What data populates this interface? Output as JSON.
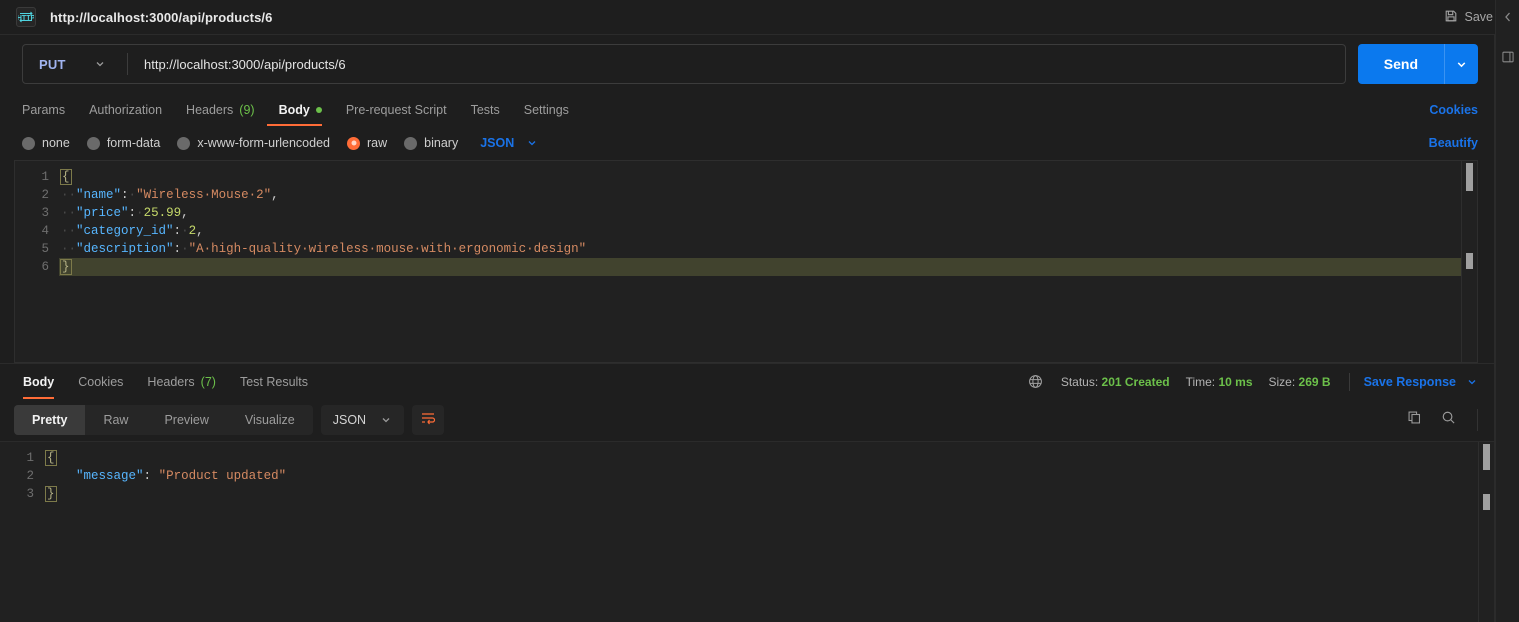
{
  "header": {
    "icon": "http-badge-icon",
    "title": "http://localhost:3000/api/products/6",
    "save_label": "Save",
    "save_icon": "floppy-disk-icon"
  },
  "right_rail": {
    "items": [
      {
        "icon": "chevron-left-icon"
      },
      {
        "icon": "panel-square-icon"
      }
    ]
  },
  "request": {
    "method": "PUT",
    "method_color": "#a1b4f0",
    "url": "http://localhost:3000/api/products/6",
    "url_placeholder": "Enter URL or paste text",
    "send_label": "Send",
    "send_color": "#0b79ee",
    "tabs": [
      {
        "label": "Params",
        "count": "",
        "active": false,
        "dot": false
      },
      {
        "label": "Authorization",
        "count": "",
        "active": false,
        "dot": false
      },
      {
        "label": "Headers",
        "count": "(9)",
        "active": false,
        "dot": false
      },
      {
        "label": "Body",
        "count": "",
        "active": true,
        "dot": true
      },
      {
        "label": "Pre-request Script",
        "count": "",
        "active": false,
        "dot": false
      },
      {
        "label": "Tests",
        "count": "",
        "active": false,
        "dot": false
      },
      {
        "label": "Settings",
        "count": "",
        "active": false,
        "dot": false
      }
    ],
    "cookies_label": "Cookies",
    "beautify_label": "Beautify",
    "body_types": [
      {
        "label": "none",
        "selected": false
      },
      {
        "label": "form-data",
        "selected": false
      },
      {
        "label": "x-www-form-urlencoded",
        "selected": false
      },
      {
        "label": "raw",
        "selected": true
      },
      {
        "label": "binary",
        "selected": false
      }
    ],
    "raw_format": "JSON",
    "accent_color": "#ff6c37",
    "body_code": {
      "lines": [
        {
          "n": "1",
          "tokens": [
            {
              "t": "{",
              "c": "brace"
            }
          ],
          "active": false
        },
        {
          "n": "2",
          "tokens": [
            {
              "t": "··",
              "c": "dot"
            },
            {
              "t": "\"name\"",
              "c": "k"
            },
            {
              "t": ":",
              "c": "p"
            },
            {
              "t": "·",
              "c": "dot"
            },
            {
              "t": "\"Wireless·Mouse·2\"",
              "c": "s"
            },
            {
              "t": ",",
              "c": "p"
            }
          ],
          "active": false
        },
        {
          "n": "3",
          "tokens": [
            {
              "t": "··",
              "c": "dot"
            },
            {
              "t": "\"price\"",
              "c": "k"
            },
            {
              "t": ":",
              "c": "p"
            },
            {
              "t": "·",
              "c": "dot"
            },
            {
              "t": "25.99",
              "c": "n"
            },
            {
              "t": ",",
              "c": "p"
            }
          ],
          "active": false
        },
        {
          "n": "4",
          "tokens": [
            {
              "t": "··",
              "c": "dot"
            },
            {
              "t": "\"category_id\"",
              "c": "k"
            },
            {
              "t": ":",
              "c": "p"
            },
            {
              "t": "·",
              "c": "dot"
            },
            {
              "t": "2",
              "c": "n"
            },
            {
              "t": ",",
              "c": "p"
            }
          ],
          "active": false
        },
        {
          "n": "5",
          "tokens": [
            {
              "t": "··",
              "c": "dot"
            },
            {
              "t": "\"description\"",
              "c": "k"
            },
            {
              "t": ":",
              "c": "p"
            },
            {
              "t": "·",
              "c": "dot"
            },
            {
              "t": "\"A·high-quality·wireless·mouse·with·ergonomic·design\"",
              "c": "s"
            }
          ],
          "active": false
        },
        {
          "n": "6",
          "tokens": [
            {
              "t": "}",
              "c": "brace"
            }
          ],
          "active": true
        }
      ]
    }
  },
  "response": {
    "tabs": [
      {
        "label": "Body",
        "count": "",
        "active": true
      },
      {
        "label": "Cookies",
        "count": "",
        "active": false
      },
      {
        "label": "Headers",
        "count": "(7)",
        "active": false
      },
      {
        "label": "Test Results",
        "count": "",
        "active": false
      }
    ],
    "globe_icon": "globe-icon",
    "status_label": "Status:",
    "status_value": "201 Created",
    "time_label": "Time:",
    "time_value": "10 ms",
    "size_label": "Size:",
    "size_value": "269 B",
    "save_response_label": "Save Response",
    "status_color": "#6cc04a",
    "view_modes": [
      {
        "label": "Pretty",
        "active": true
      },
      {
        "label": "Raw",
        "active": false
      },
      {
        "label": "Preview",
        "active": false
      },
      {
        "label": "Visualize",
        "active": false
      }
    ],
    "format": "JSON",
    "wrap_icon": "word-wrap-icon",
    "copy_icon": "copy-icon",
    "search_icon": "search-icon",
    "body_code": {
      "lines": [
        {
          "n": "1",
          "tokens": [
            {
              "t": "{",
              "c": "brace"
            }
          ],
          "active": false
        },
        {
          "n": "2",
          "tokens": [
            {
              "t": "    ",
              "c": "p"
            },
            {
              "t": "\"message\"",
              "c": "k"
            },
            {
              "t": ":",
              "c": "p"
            },
            {
              "t": " ",
              "c": "p"
            },
            {
              "t": "\"Product updated\"",
              "c": "s"
            }
          ],
          "active": false
        },
        {
          "n": "3",
          "tokens": [
            {
              "t": "}",
              "c": "brace"
            }
          ],
          "active": false
        }
      ]
    }
  }
}
